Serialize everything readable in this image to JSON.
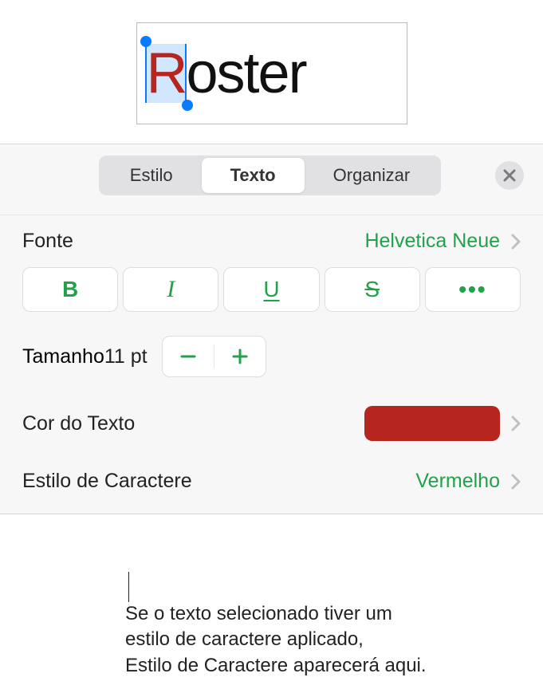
{
  "preview": {
    "selected_char": "R",
    "rest": "oster"
  },
  "tabs": {
    "items": [
      "Estilo",
      "Texto",
      "Organizar"
    ],
    "active_index": 1
  },
  "font_row": {
    "label": "Fonte",
    "value": "Helvetica Neue"
  },
  "style_buttons": {
    "bold": "B",
    "italic": "I",
    "underline": "U",
    "strike": "S",
    "more": "•••"
  },
  "size_row": {
    "label": "Tamanho",
    "value": "11 pt"
  },
  "color_row": {
    "label": "Cor do Texto",
    "swatch": "#b7261e"
  },
  "char_style_row": {
    "label": "Estilo de Caractere",
    "value": "Vermelho"
  },
  "callout": {
    "line1": "Se o texto selecionado tiver um",
    "line2": "estilo de caractere aplicado,",
    "line3": "Estilo de Caractere aparecerá aqui."
  }
}
